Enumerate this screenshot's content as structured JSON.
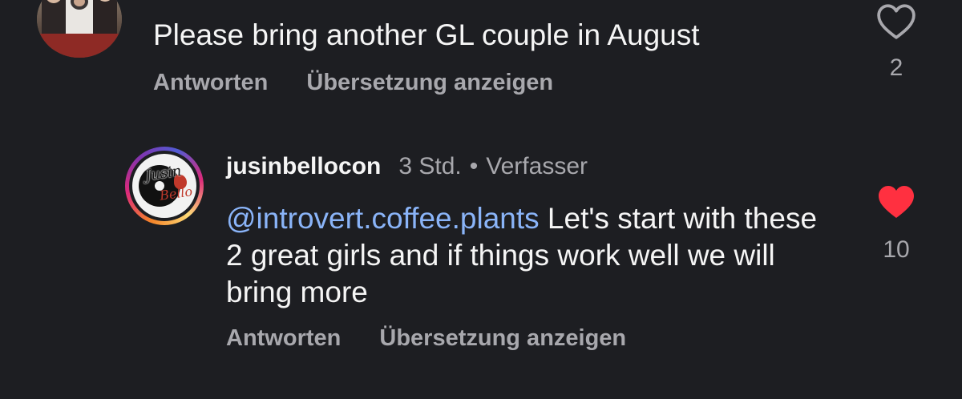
{
  "comments": [
    {
      "text": "Please bring another GL couple in August",
      "reply_label": "Antworten",
      "translate_label": "Übersetzung anzeigen",
      "like_count": "2",
      "liked": false,
      "avatar_icon": "group-photo-avatar"
    },
    {
      "username": "jusinbellocon",
      "time": "3 Std.",
      "separator": "•",
      "badge": "Verfasser",
      "mention": "@introvert.coffee.plants",
      "text": " Let's start with these 2 great girls and if things work well we will bring more",
      "reply_label": "Antworten",
      "translate_label": "Übersetzung anzeigen",
      "like_count": "10",
      "liked": true,
      "avatar_text_1": "Jusin",
      "avatar_text_2": "Bello",
      "avatar_icon": "film-reel-logo-avatar"
    }
  ],
  "colors": {
    "background": "#1d1e22",
    "primary_text": "#f5f5f5",
    "secondary_text": "#a8a8ad",
    "mention": "#8ab4f8",
    "like_red": "#ff3040"
  }
}
